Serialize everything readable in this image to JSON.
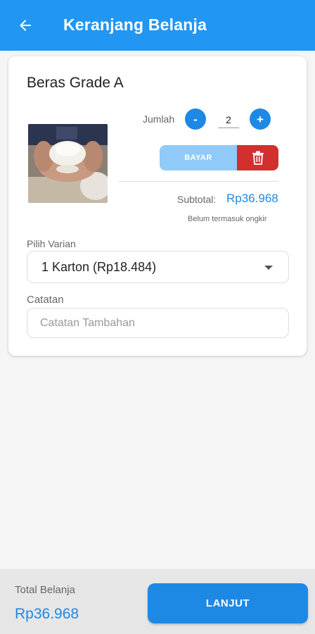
{
  "appbar": {
    "title": "Keranjang Belanja",
    "back_icon": "arrow-left-icon"
  },
  "cart_item": {
    "name": "Beras Grade A",
    "image_desc_icon": "rice-in-hands-image",
    "quantity_label": "Jumlah",
    "quantity_value": "2",
    "minus_label": "-",
    "plus_label": "+",
    "pay_label": "BAYAR",
    "delete_icon": "trash-icon",
    "subtotal_label": "Subtotal:",
    "subtotal_value": "Rp36.968",
    "ongkir_note": "Belum termasuk ongkir",
    "variant_label": "Pilih Varian",
    "variant_selected": "1 Karton (Rp18.484)",
    "note_label": "Catatan",
    "note_placeholder": "Catatan Tambahan",
    "note_value": ""
  },
  "footer": {
    "total_label": "Total Belanja",
    "total_value": "Rp36.968",
    "next_label": "LANJUT"
  },
  "colors": {
    "primary": "#2196f3",
    "accent_blue": "#1e88e5",
    "pay_disabled": "#90caf9",
    "delete_red": "#d32f2f"
  }
}
